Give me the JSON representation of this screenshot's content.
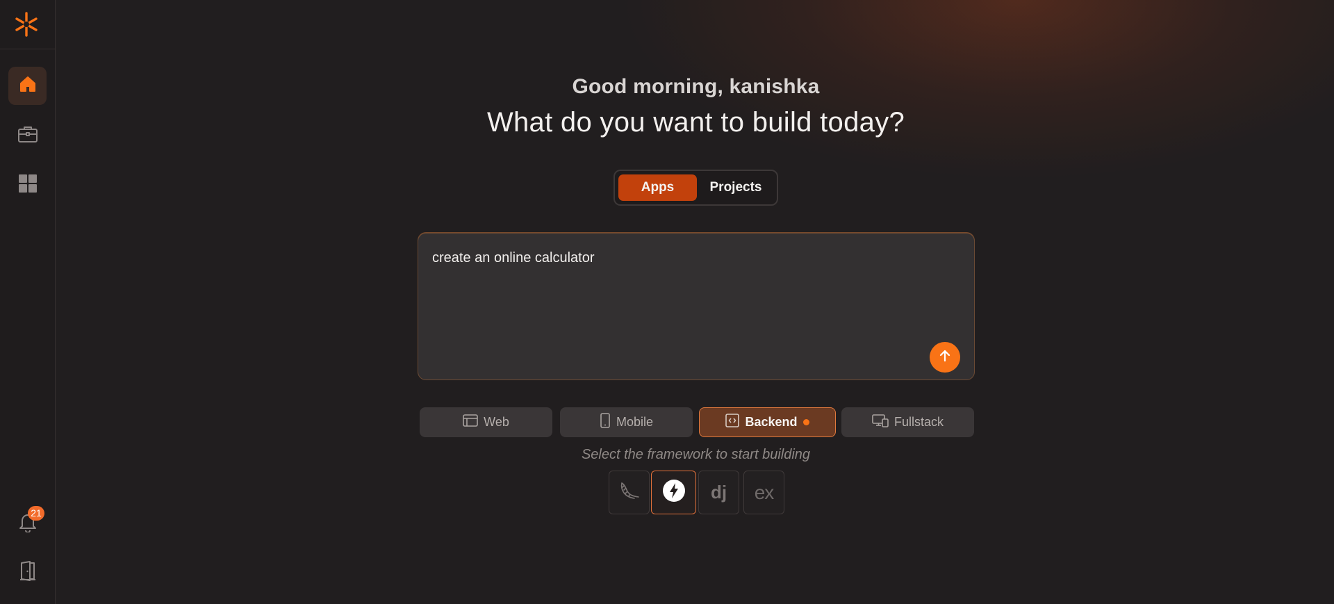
{
  "colors": {
    "accent": "#f97316",
    "accent_dark": "#c2410c",
    "background": "#211e1f",
    "badge": "#f26b2b"
  },
  "sidebar": {
    "logo_icon": "asterisk-logo-icon",
    "items": [
      {
        "name": "home",
        "icon": "home-icon",
        "active": true
      },
      {
        "name": "briefcase",
        "icon": "briefcase-icon",
        "active": false
      },
      {
        "name": "apps-grid",
        "icon": "grid-icon",
        "active": false
      }
    ],
    "notifications": {
      "icon": "bell-icon",
      "count": "21"
    },
    "logout": {
      "icon": "door-exit-icon"
    }
  },
  "main": {
    "greeting": "Good morning, kanishka",
    "headline": "What do you want to build today?",
    "toggle": {
      "options": [
        "Apps",
        "Projects"
      ],
      "selected": "Apps"
    },
    "prompt": {
      "value": "create an online calculator",
      "send_icon": "arrow-up-icon"
    },
    "app_types": [
      {
        "label": "Web",
        "icon": "browser-window-icon",
        "selected": false
      },
      {
        "label": "Mobile",
        "icon": "smartphone-icon",
        "selected": false
      },
      {
        "label": "Backend",
        "icon": "code-box-icon",
        "selected": true
      },
      {
        "label": "Fullstack",
        "icon": "devices-icon",
        "selected": false
      }
    ],
    "framework_hint": "Select the framework to start building",
    "frameworks": [
      {
        "name": "Flask",
        "icon": "flask-horn-icon",
        "selected": false
      },
      {
        "name": "FastAPI",
        "icon": "fastapi-bolt-icon",
        "selected": true
      },
      {
        "name": "Django",
        "label": "dj",
        "icon": "django-icon",
        "selected": false
      },
      {
        "name": "Express",
        "label": "ex",
        "icon": "express-icon",
        "selected": false
      }
    ]
  }
}
